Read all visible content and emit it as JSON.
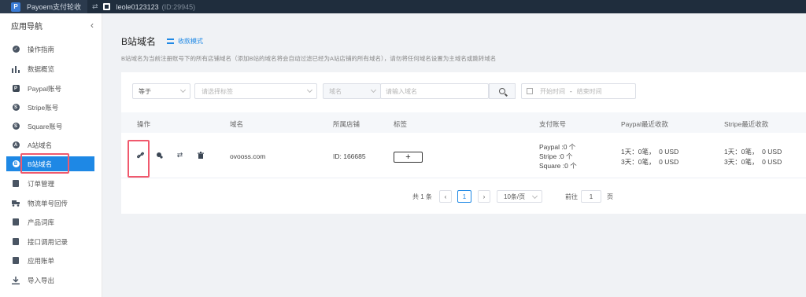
{
  "topbar": {
    "brand": "Payoem支付轮收",
    "store_name": "leole0123123",
    "store_id": "(ID:29945)"
  },
  "sidebar": {
    "title": "应用导航",
    "collapse_icon": "chevron-left-icon",
    "items": [
      {
        "label": "操作指南",
        "icon": "check-circle-icon"
      },
      {
        "label": "数据概览",
        "icon": "bar-chart-icon"
      },
      {
        "label": "Paypal账号",
        "icon": "paypal-icon"
      },
      {
        "label": "Stripe账号",
        "icon": "stripe-icon"
      },
      {
        "label": "Square账号",
        "icon": "square-icon"
      },
      {
        "label": "A站域名",
        "icon": "a-site-icon"
      },
      {
        "label": "B站域名",
        "icon": "b-site-icon",
        "active": true
      },
      {
        "label": "订单管理",
        "icon": "order-icon"
      },
      {
        "label": "物流单号回传",
        "icon": "truck-icon"
      },
      {
        "label": "产品词库",
        "icon": "product-icon"
      },
      {
        "label": "接口调用记录",
        "icon": "log-icon"
      },
      {
        "label": "应用账单",
        "icon": "bill-icon"
      },
      {
        "label": "导入导出",
        "icon": "download-icon"
      }
    ]
  },
  "header": {
    "title": "B站域名",
    "mode_label": "收款模式",
    "description": "B站域名为当前注册账号下的所有店铺域名（添加B站的域名将会自动过滤已经为A站店铺的所有域名），请勿将任何域名设置为主域名或跳转域名"
  },
  "filters": {
    "match_select": "等于",
    "tag_placeholder": "请选择标签",
    "field_select": "域名",
    "domain_placeholder": "请输入域名",
    "date_start_placeholder": "开始时间",
    "date_sep": "-",
    "date_end_placeholder": "结束时间"
  },
  "table": {
    "headers": {
      "actions": "操作",
      "domain": "域名",
      "store": "所属店铺",
      "tag": "标签",
      "payment": "支付账号",
      "paypal_recent": "Paypal最近收款",
      "stripe_recent": "Stripe最近收款"
    },
    "rows": [
      {
        "domain": "ovooss.com",
        "store": "ID: 166685",
        "tag_add": "+",
        "payment": [
          "Paypal :0 个",
          "Stripe :0 个",
          "Square :0 个"
        ],
        "paypal_recent": [
          "1天：0笔，  0 USD",
          "3天：0笔，  0 USD"
        ],
        "stripe_recent": [
          "1天：0笔，  0 USD",
          "3天：0笔，  0 USD"
        ]
      }
    ]
  },
  "pagination": {
    "total": "共 1 条",
    "current_page": "1",
    "page_size": "10条/页",
    "goto_label": "前往",
    "goto_value": "1",
    "page_suffix": "页"
  },
  "colors": {
    "accent": "#1e88e5",
    "highlight": "#f0596d",
    "topbar": "#1f2d3d"
  }
}
